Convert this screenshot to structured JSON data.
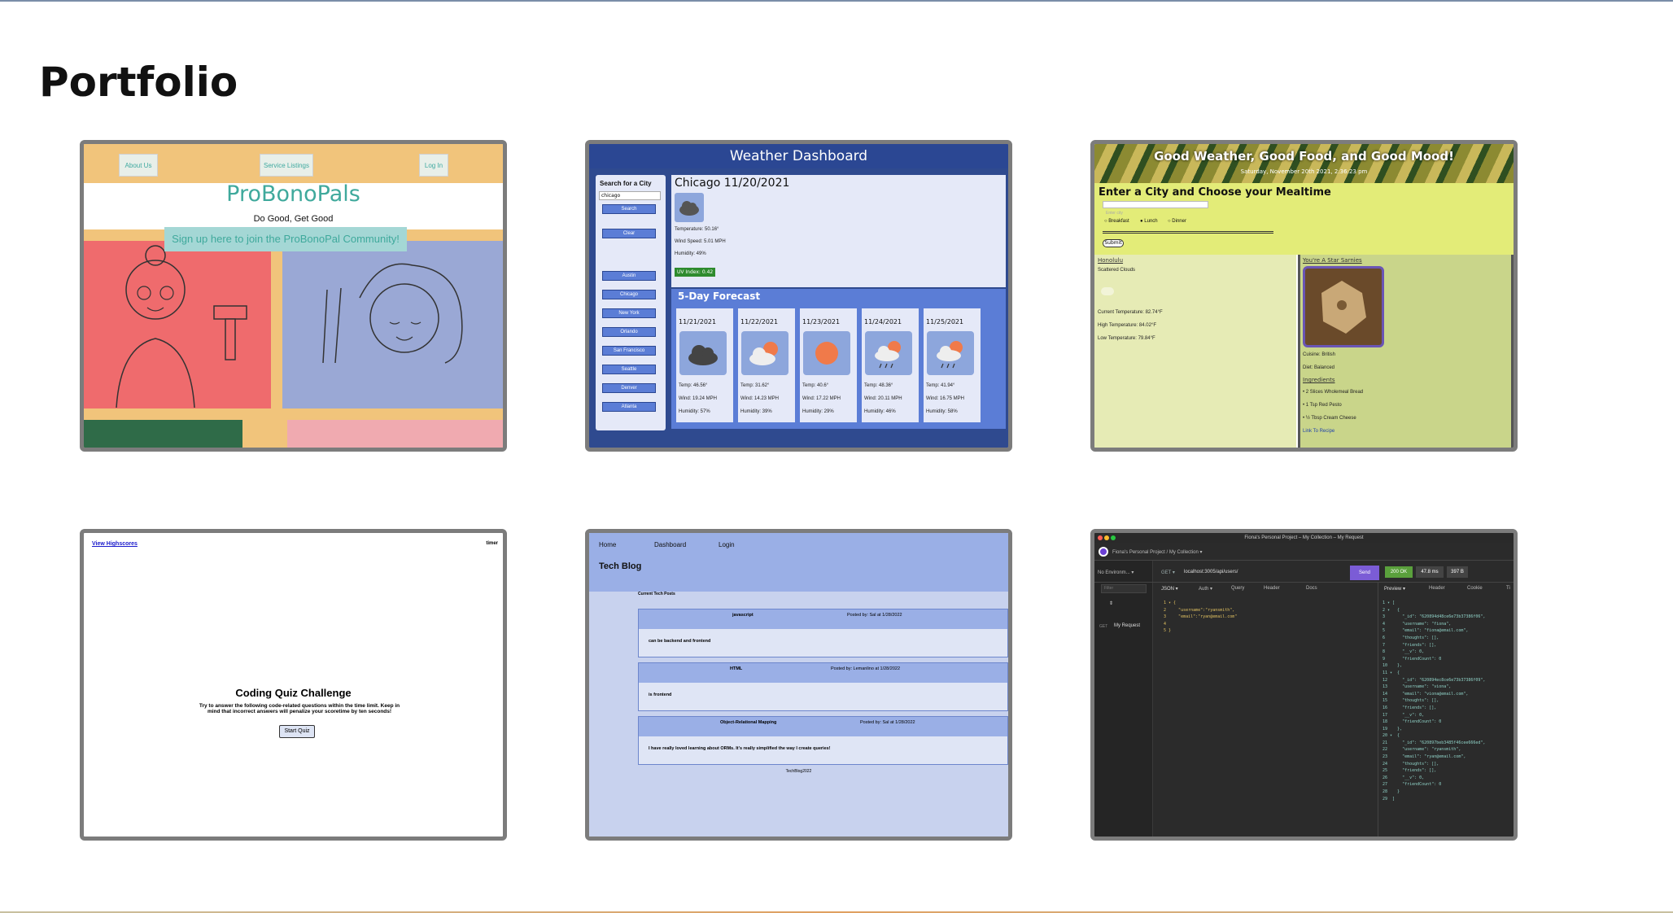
{
  "page": {
    "title": "Portfolio"
  },
  "cards": {
    "probono": {
      "nav": [
        "About Us",
        "Service Listings",
        "Log In"
      ],
      "title": "ProBonoPals",
      "tagline": "Do Good, Get Good",
      "signup": "Sign up here to join the ProBonoPal Community!"
    },
    "weather": {
      "header": "Weather Dashboard",
      "search_label": "Search for a City",
      "search_value": "chicago",
      "search_button": "Search",
      "clear_button": "Clear",
      "cities": [
        "Austin",
        "Chicago",
        "New York",
        "Orlando",
        "San Francisco",
        "Seattle",
        "Denver",
        "Atlanta"
      ],
      "current": {
        "city_date": "Chicago  11/20/2021",
        "temp": "Temperature: 50.16°",
        "wind": "Wind Speed: 5.01 MPH",
        "humidity": "Humidity: 49%",
        "uv": "UV Index: 0.42"
      },
      "forecast_title": "5-Day Forecast",
      "forecast": [
        {
          "date": "11/21/2021",
          "temp": "Temp: 46.56°",
          "wind": "Wind: 19.24 MPH",
          "humidity": "Humidity: 57%",
          "icon": "cloud-icon"
        },
        {
          "date": "11/22/2021",
          "temp": "Temp: 31.62°",
          "wind": "Wind: 14.23 MPH",
          "humidity": "Humidity: 39%",
          "icon": "sun-cloud-icon"
        },
        {
          "date": "11/23/2021",
          "temp": "Temp: 40.6°",
          "wind": "Wind: 17.22 MPH",
          "humidity": "Humidity: 29%",
          "icon": "sun-icon"
        },
        {
          "date": "11/24/2021",
          "temp": "Temp: 48.36°",
          "wind": "Wind: 20.11 MPH",
          "humidity": "Humidity: 46%",
          "icon": "rain-icon"
        },
        {
          "date": "11/25/2021",
          "temp": "Temp: 41.94°",
          "wind": "Wind: 16.75 MPH",
          "humidity": "Humidity: 58%",
          "icon": "rain-icon"
        }
      ]
    },
    "goodmood": {
      "header": "Good Weather, Good Food, and Good Mood!",
      "date": "Saturday, November 20th 2021, 2:36:23 pm",
      "prompt": "Enter a City and Choose your Mealtime",
      "placeholder": "Enter city",
      "meals": [
        "Breakfast",
        "Lunch",
        "Dinner"
      ],
      "submit": "Submit",
      "city": "Honolulu",
      "conditions": "Scattered Clouds",
      "current_temp": "Current Temperature: 82.74°F",
      "high_temp": "High Temperature: 84.02°F",
      "low_temp": "Low Temperature: 79.84°F",
      "recipe_title": "You're A Star Sarnies",
      "cuisine": "Cuisine: British",
      "diet": "Diet: Balanced",
      "ingredients_title": "Ingredients",
      "ingredients": [
        "• 2 Slices Wholemeal Bread",
        "• 1 Tsp Red Pesto",
        "• ½ Tbsp Cream Cheese"
      ],
      "recipe_link": "Link To Recipe"
    },
    "quiz": {
      "highscores": "View Highscores",
      "timer": "timer",
      "title": "Coding Quiz Challenge",
      "description": "Try to answer the following code-related questions within the time limit. Keep in mind that incorrect answers will penalize your scoretime by ten seconds!",
      "start": "Start Quiz"
    },
    "techblog": {
      "nav": [
        "Home",
        "Dashboard",
        "Login"
      ],
      "title": "Tech Blog",
      "subtitle": "Current Tech Posts",
      "posts": [
        {
          "title": "javascript",
          "meta": "Posted by: Sal at 1/28/2022",
          "body": "can be backend and frontend"
        },
        {
          "title": "HTML",
          "meta": "Posted by: Lemanlino at 1/28/2022",
          "body": "is frontend"
        },
        {
          "title": "Object-Relational Mapping",
          "meta": "Posted by: Sal at 1/28/2022",
          "body": "I have really loved learning about ORMs. It's really simplified the way I create queries!"
        }
      ],
      "footer": "TechBlog2022"
    },
    "insomnia": {
      "window_title": "Fiona's Personal Project – My Collection – My Request",
      "breadcrumb": "Fiona's Personal Project / My Collection ▾",
      "env": "No Environm... ▾",
      "filter": "Filter",
      "method": "GET ▾",
      "url": "localhost:3005/api/users/",
      "send": "Send",
      "status": "200 OK",
      "time": "47.8 ms",
      "size": "397 B",
      "request_tabs": [
        "JSON ▾",
        "Auth ▾",
        "Query",
        "Header",
        "Docs"
      ],
      "response_tabs": [
        "Preview ▾",
        "Header",
        "Cookie",
        "Ti"
      ],
      "sidebar_method": "GET",
      "sidebar_request": "My Request",
      "request_body": "1 ▾ {\n2     \"username\":\"ryansmith\",\n3     \"email\":\"ryan@email.com\"\n4\n5 }",
      "response_body": "1 ▾ [\n2 ▾   {\n3       \"_id\": \"620894d48ce6e73b37386f06\",\n4       \"username\": \"fiona\",\n5       \"email\": \"fiona@email.com\",\n6       \"thoughts\": [],\n7       \"friends\": [],\n8       \"__v\": 0,\n9       \"friendCount\": 0\n10    },\n11 ▾  {\n12      \"_id\": \"620894ec8ce6e73b37386f09\",\n13      \"username\": \"viona\",\n14      \"email\": \"viona@email.com\",\n15      \"thoughts\": [],\n16      \"friends\": [],\n17      \"__v\": 0,\n18      \"friendCount\": 0\n19    },\n20 ▾  {\n21      \"_id\": \"620897beb3485f46cee666ed\",\n22      \"username\": \"ryansmith\",\n23      \"email\": \"ryan@email.com\",\n24      \"thoughts\": [],\n25      \"friends\": [],\n26      \"__v\": 0,\n27      \"friendCount\": 0\n28    }\n29  ]"
    }
  }
}
